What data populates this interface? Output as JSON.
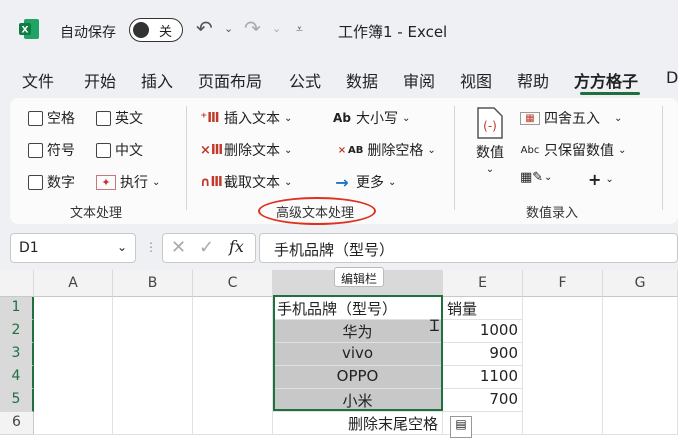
{
  "titlebar": {
    "autosave_label": "自动保存",
    "autosave_state": "关",
    "doc_title": "工作簿1  -  Excel"
  },
  "tabs": [
    "文件",
    "开始",
    "插入",
    "页面布局",
    "公式",
    "数据",
    "审阅",
    "视图",
    "帮助",
    "方方格子",
    "D"
  ],
  "ribbon": {
    "text_group": {
      "items": [
        "空格",
        "英文",
        "符号",
        "中文",
        "数字",
        "执行"
      ],
      "label": "文本处理"
    },
    "adv_group": {
      "insert": "插入文本",
      "delete": "删除文本",
      "extract": "截取文本",
      "case": "大小写",
      "remove_space": "删除空格",
      "more": "更多",
      "case_icon": "Ab",
      "space_icon": "AB",
      "label": "高级文本处理"
    },
    "num_group": {
      "value": "数值",
      "round": "四舍五入",
      "keep": "只保留数值",
      "abc": "Abc",
      "label": "数值录入"
    }
  },
  "formula_bar": {
    "name_box": "D1",
    "fx": "fx",
    "formula": "手机品牌（型号）",
    "tooltip": "编辑栏"
  },
  "grid": {
    "columns": [
      "A",
      "B",
      "C",
      "D",
      "E",
      "F",
      "G"
    ],
    "rows": [
      "1",
      "2",
      "3",
      "4",
      "5",
      "6"
    ],
    "cells": {
      "D1": "手机品牌（型号）",
      "E1": "销量",
      "D2": "华为",
      "E2": "1000",
      "D3": "vivo",
      "E3": "900",
      "D4": "OPPO",
      "E4": "1100",
      "D5": "小米",
      "E5": "700",
      "D6": "删除末尾空格"
    }
  },
  "colors": {
    "accent": "#1f6f3f",
    "highlight": "#e03020"
  }
}
